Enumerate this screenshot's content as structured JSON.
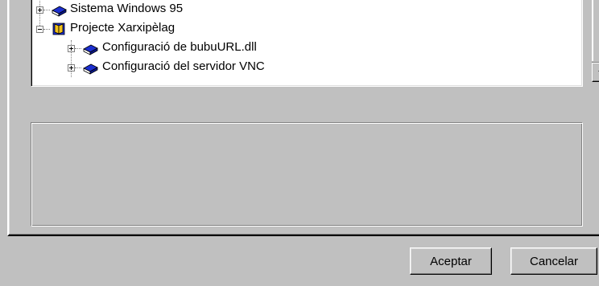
{
  "tree": {
    "nodes": [
      {
        "label": "Sistema Windows 95",
        "expander": "plus",
        "icon": "closed-book-icon"
      },
      {
        "label": "Projecte Xarxipèlag",
        "expander": "minus",
        "icon": "open-book-icon"
      },
      {
        "label": "Configuració de bubuURL.dll",
        "expander": "plus",
        "icon": "closed-book-icon"
      },
      {
        "label": "Configuració del servidor VNC",
        "expander": "plus",
        "icon": "closed-book-icon"
      }
    ]
  },
  "description": {
    "text": ""
  },
  "buttons": {
    "accept_label": "Aceptar",
    "cancel_label": "Cancelar"
  },
  "colors": {
    "face": "#c0c0c0",
    "book_blue": "#1c2fd0",
    "book_yellow": "#f2c21b"
  }
}
